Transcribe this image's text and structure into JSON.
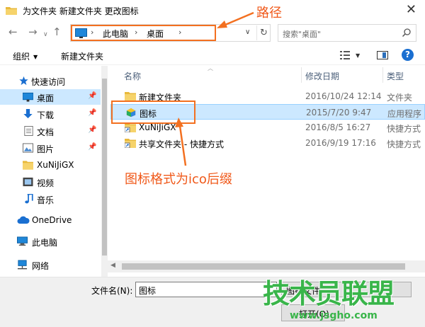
{
  "window": {
    "title": "为文件夹 新建文件夹 更改图标",
    "close_glyph": "✕"
  },
  "address": {
    "crumbs": [
      "此电脑",
      "桌面"
    ],
    "search_placeholder": "搜索\"桌面\""
  },
  "annotations": {
    "path_label": "路径",
    "icon_format_label": "图标格式为ico后缀"
  },
  "toolbar": {
    "organize_label": "组织",
    "new_folder_label": "新建文件夹",
    "help_label": "?"
  },
  "sidebar": {
    "items": [
      {
        "label": "快速访问",
        "icon": "star-icon",
        "color": "#1a6fd1"
      },
      {
        "label": "桌面",
        "icon": "desktop-icon",
        "pinned": true,
        "selected": true
      },
      {
        "label": "下载",
        "icon": "download-icon",
        "pinned": true
      },
      {
        "label": "文档",
        "icon": "document-icon",
        "pinned": true
      },
      {
        "label": "图片",
        "icon": "picture-icon",
        "pinned": true
      },
      {
        "label": "XuNiJiGX",
        "icon": "folder-icon"
      },
      {
        "label": "视频",
        "icon": "video-icon"
      },
      {
        "label": "音乐",
        "icon": "music-icon"
      },
      {
        "label": "OneDrive",
        "icon": "cloud-icon"
      },
      {
        "label": "此电脑",
        "icon": "computer-icon"
      },
      {
        "label": "网络",
        "icon": "network-icon"
      }
    ]
  },
  "file_list": {
    "columns": [
      "名称",
      "修改日期",
      "类型"
    ],
    "rows": [
      {
        "name": "新建文件夹",
        "date": "2016/10/24 12:14",
        "type": "文件夹",
        "icon": "folder-icon"
      },
      {
        "name": "图标",
        "date": "2015/7/20 9:47",
        "type": "应用程序",
        "icon": "app-icon",
        "selected": true
      },
      {
        "name": "XuNiJiGX",
        "date": "2016/8/5 16:27",
        "type": "快捷方式",
        "icon": "shortcut-icon"
      },
      {
        "name": "共享文件夹 - 快捷方式",
        "date": "2016/9/19 17:16",
        "type": "快捷方式",
        "icon": "shortcut-icon"
      }
    ]
  },
  "bottom": {
    "filename_label": "文件名(N):",
    "filename_value": "图标",
    "filetype_value": "图标文件",
    "open_label": "打开(O)"
  },
  "watermark": {
    "brand": "技术员联盟",
    "url": "www.jsgho.com"
  },
  "colors": {
    "accent_orange": "#f37020",
    "selection_blue": "#cce8ff",
    "watermark_green": "#39b54a"
  }
}
